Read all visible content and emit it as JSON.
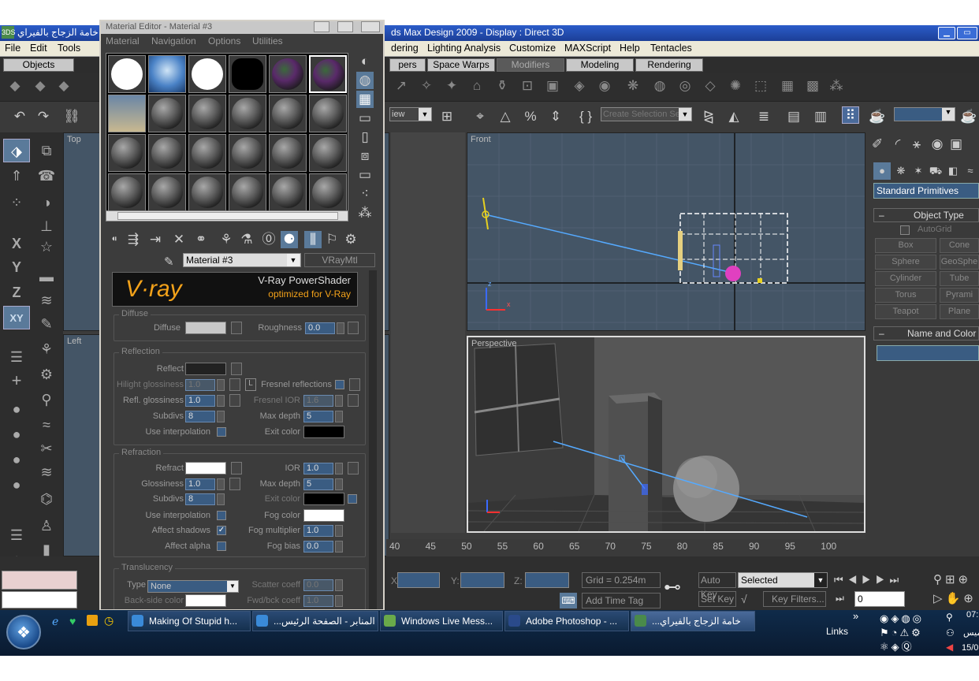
{
  "window": {
    "title_rtl": "خامة الزجاج بالفيراي",
    "title_main": "ds Max Design 2009     - Display : Direct 3D",
    "app_icon": "3DS"
  },
  "menu": {
    "file": "File",
    "edit": "Edit",
    "tools": "Tools",
    "lighting": "Lighting Analysis",
    "customize": "Customize",
    "maxscript": "MAXScript",
    "help": "Help",
    "tentacles": "Tentacles",
    "rendering_part": "dering"
  },
  "tabs": {
    "objects": "Objects",
    "helpers_part": "pers",
    "space_warps": "Space Warps",
    "modifiers": "Modifiers",
    "modeling": "Modeling",
    "rendering": "Rendering"
  },
  "toolbar": {
    "view_part": "iew",
    "selection_set_placeholder": "Create Selection Se"
  },
  "left_axis": {
    "x": "X",
    "y": "Y",
    "z": "Z",
    "xy": "XY"
  },
  "viewports": {
    "top": "Top",
    "left": "Left",
    "front": "Front",
    "perspective": "Perspective"
  },
  "timeline": {
    "ticks": [
      "40",
      "45",
      "50",
      "55",
      "60",
      "65",
      "70",
      "75",
      "80",
      "85",
      "90",
      "95",
      "100"
    ]
  },
  "status": {
    "x_label": "X:",
    "y_label": "Y:",
    "z_label": "Z:",
    "grid": "Grid = 0.254m",
    "auto_key": "Auto Key",
    "selected": "Selected",
    "set_key": "Set Key",
    "key_filters": "Key Filters...",
    "add_time_tag": "Add Time Tag",
    "frame": "0"
  },
  "cmd_panel": {
    "category": "Standard Primitives",
    "object_type": "Object Type",
    "autogrid": "AutoGrid",
    "buttons": [
      "Box",
      "Cone",
      "Sphere",
      "GeoSphe",
      "Cylinder",
      "Tube",
      "Torus",
      "Pyrami",
      "Teapot",
      "Plane"
    ],
    "name_color": "Name and Color"
  },
  "material_editor": {
    "title": "Material Editor - Material #3",
    "menu": {
      "material": "Material",
      "navigation": "Navigation",
      "options": "Options",
      "utilities": "Utilities"
    },
    "material_name": "Material #3",
    "material_type": "VRayMtl",
    "vray_logo": "V·ray",
    "vray_line1": "V-Ray PowerShader",
    "vray_line2": "optimized for V-Ray",
    "diffuse": {
      "section": "Diffuse",
      "diffuse_label": "Diffuse",
      "roughness_label": "Roughness",
      "roughness": "0.0"
    },
    "reflection": {
      "section": "Reflection",
      "reflect_label": "Reflect",
      "hilight_label": "Hilight glossiness",
      "hilight": "1.0",
      "l_button": "L",
      "fresnel_label": "Fresnel reflections",
      "refl_gloss_label": "Refl. glossiness",
      "refl_gloss": "1.0",
      "fresnel_ior_label": "Fresnel IOR",
      "fresnel_ior": "1.6",
      "subdivs_label": "Subdivs",
      "subdivs": "8",
      "max_depth_label": "Max depth",
      "max_depth": "5",
      "use_interp_label": "Use interpolation",
      "exit_color_label": "Exit color"
    },
    "refraction": {
      "section": "Refraction",
      "refract_label": "Refract",
      "ior_label": "IOR",
      "ior": "1.0",
      "gloss_label": "Glossiness",
      "gloss": "1.0",
      "max_depth_label": "Max depth",
      "max_depth": "5",
      "subdivs_label": "Subdivs",
      "subdivs": "8",
      "exit_color_label": "Exit color",
      "use_interp_label": "Use interpolation",
      "fog_color_label": "Fog color",
      "affect_shadows_label": "Affect shadows",
      "fog_mult_label": "Fog multiplier",
      "fog_mult": "1.0",
      "affect_alpha_label": "Affect alpha",
      "fog_bias_label": "Fog bias",
      "fog_bias": "0.0"
    },
    "translucency": {
      "section": "Translucency",
      "type_label": "Type",
      "type": "None",
      "scatter_label": "Scatter coeff",
      "scatter": "0.0",
      "backside_label": "Back-side color",
      "fwd_label": "Fwd/bck coeff",
      "fwd": "1.0"
    }
  },
  "taskbar": {
    "items": [
      "Making Of Stupid h...",
      "...المنابر - الصفحة الرئيس",
      "Windows Live Mess...",
      "Adobe Photoshop - ...",
      "...خامة الزجاج بالفيراي"
    ],
    "links": "Links",
    "chevron": "»",
    "clock": "07:",
    "day": "ميس",
    "date": "15/0"
  }
}
